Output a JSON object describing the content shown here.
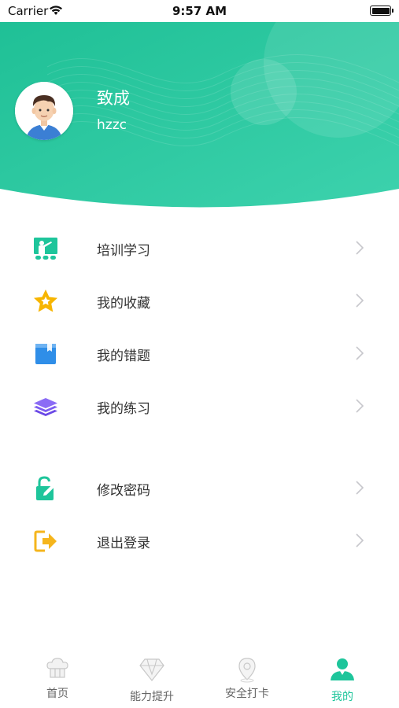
{
  "status_bar": {
    "carrier": "Carrier",
    "time": "9:57 AM"
  },
  "profile": {
    "name": "致成",
    "username": "hzzc"
  },
  "menu": {
    "items": [
      {
        "label": "培训学习",
        "icon": "training-board-icon"
      },
      {
        "label": "我的收藏",
        "icon": "star-icon"
      },
      {
        "label": "我的错题",
        "icon": "bookmark-folder-icon"
      },
      {
        "label": "我的练习",
        "icon": "layers-icon"
      },
      {
        "label": "修改密码",
        "icon": "lock-edit-icon"
      },
      {
        "label": "退出登录",
        "icon": "logout-icon"
      }
    ]
  },
  "tabbar": {
    "items": [
      {
        "label": "首页",
        "icon": "home-hat-icon"
      },
      {
        "label": "能力提升",
        "icon": "diamond-icon"
      },
      {
        "label": "安全打卡",
        "icon": "location-pin-icon"
      },
      {
        "label": "我的",
        "icon": "user-icon"
      }
    ],
    "active_index": 3
  },
  "colors": {
    "primary": "#1ec59b",
    "header_gradient_start": "#22c39a",
    "header_gradient_end": "#3fd3b0",
    "star": "#f7b500",
    "bookmark": "#2f8ee8",
    "layers": "#7c5cf0",
    "logout": "#f5b51c"
  }
}
